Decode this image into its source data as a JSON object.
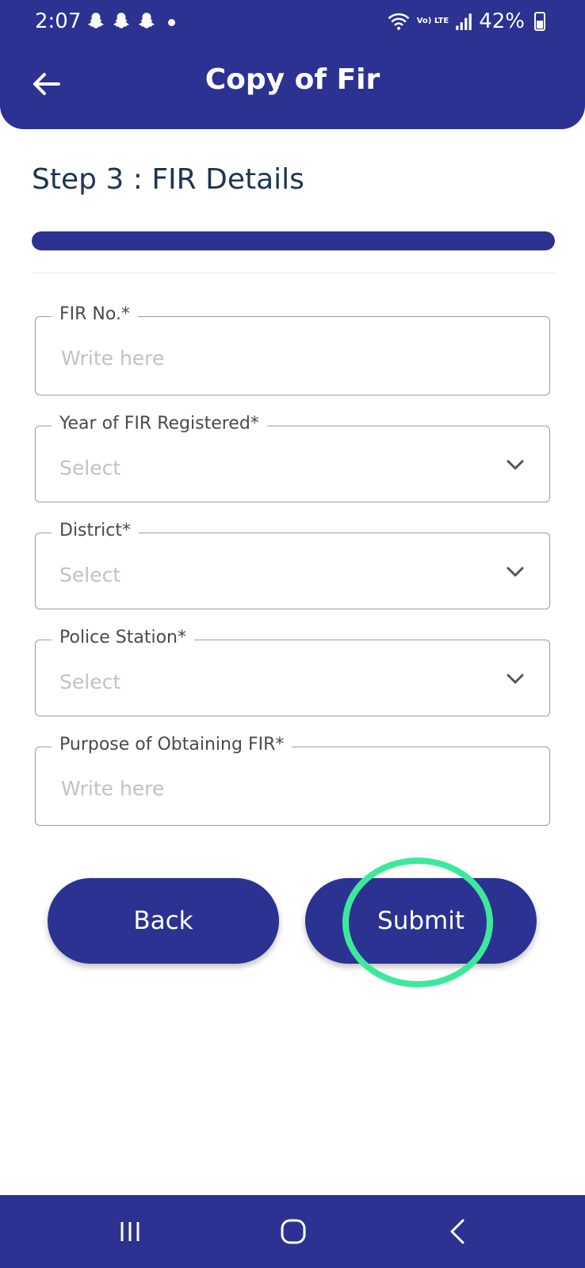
{
  "status_bar": {
    "time": "2:07",
    "battery": "42%",
    "network": "Vo) LTE"
  },
  "header": {
    "title": "Copy of Fir"
  },
  "step": {
    "title": "Step 3 : FIR Details",
    "progress_percent": 100
  },
  "form": {
    "fir_no": {
      "label": "FIR No.*",
      "placeholder": "Write here"
    },
    "year": {
      "label": "Year of FIR Registered*",
      "value": "Select"
    },
    "district": {
      "label": "District*",
      "value": "Select"
    },
    "police_station": {
      "label": "Police Station*",
      "value": "Select"
    },
    "purpose": {
      "label": "Purpose of Obtaining FIR*",
      "placeholder": "Write here"
    }
  },
  "buttons": {
    "back": "Back",
    "submit": "Submit"
  },
  "colors": {
    "primary": "#2b3291",
    "highlight": "#3ee89b"
  },
  "icons": [
    "back-arrow-icon",
    "chevron-down-icon",
    "snapchat-icon",
    "wifi-icon",
    "signal-icon",
    "battery-icon",
    "recent-apps-icon",
    "home-icon",
    "nav-back-icon"
  ]
}
